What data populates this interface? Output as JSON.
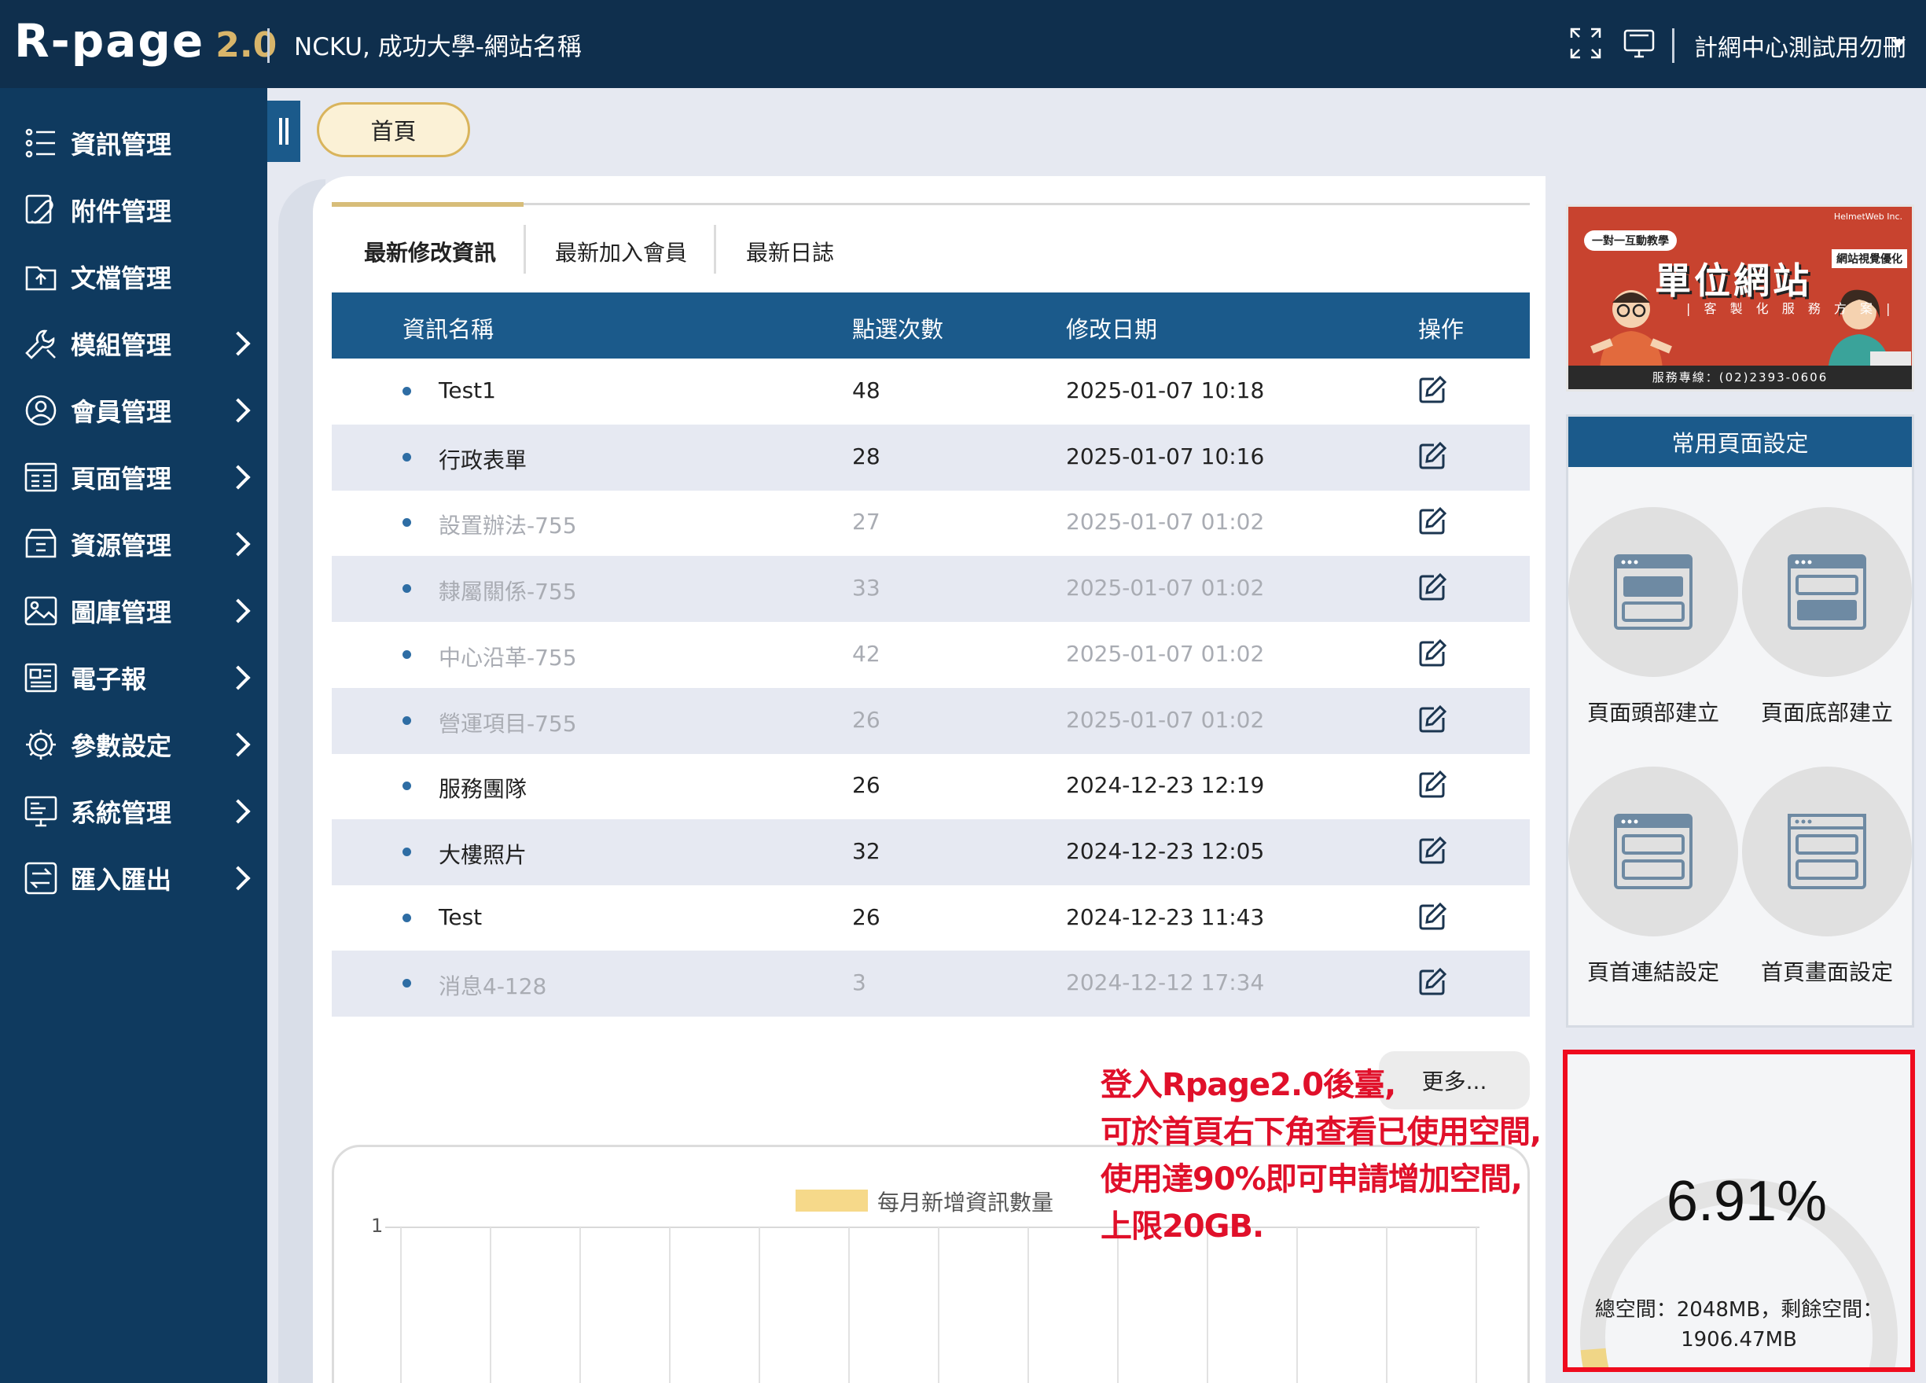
{
  "header": {
    "logo_main": "R-page",
    "logo_version": "2.0",
    "site_name": "NCKU, 成功大學-網站名稱",
    "user_name": "計網中心測試用勿刪",
    "icons": [
      "fullscreen-icon",
      "monitor-icon",
      "caret-down-icon"
    ]
  },
  "sidebar": {
    "items": [
      {
        "label": "資訊管理",
        "icon": "list-icon",
        "expandable": false
      },
      {
        "label": "附件管理",
        "icon": "attachment-icon",
        "expandable": false
      },
      {
        "label": "文檔管理",
        "icon": "document-upload-icon",
        "expandable": false
      },
      {
        "label": "模組管理",
        "icon": "wrench-icon",
        "expandable": true
      },
      {
        "label": "會員管理",
        "icon": "user-circle-icon",
        "expandable": true
      },
      {
        "label": "頁面管理",
        "icon": "page-layout-icon",
        "expandable": true
      },
      {
        "label": "資源管理",
        "icon": "archive-box-icon",
        "expandable": true
      },
      {
        "label": "圖庫管理",
        "icon": "image-icon",
        "expandable": true
      },
      {
        "label": "電子報",
        "icon": "newsletter-icon",
        "expandable": true
      },
      {
        "label": "參數設定",
        "icon": "gear-icon",
        "expandable": true
      },
      {
        "label": "系統管理",
        "icon": "monitor-icon",
        "expandable": true
      },
      {
        "label": "匯入匯出",
        "icon": "import-export-icon",
        "expandable": true
      }
    ]
  },
  "breadcrumb": {
    "home": "首頁"
  },
  "tabs": [
    {
      "label": "最新修改資訊",
      "active": true
    },
    {
      "label": "最新加入會員",
      "active": false
    },
    {
      "label": "最新日誌",
      "active": false
    }
  ],
  "table": {
    "columns": [
      "資訊名稱",
      "點選次數",
      "修改日期",
      "操作"
    ],
    "rows": [
      {
        "name": "Test1",
        "clicks": "48",
        "date": "2025-01-07 10:18",
        "muted": false
      },
      {
        "name": "行政表單",
        "clicks": "28",
        "date": "2025-01-07 10:16",
        "muted": false
      },
      {
        "name": "設置辦法-755",
        "clicks": "27",
        "date": "2025-01-07 01:02",
        "muted": true
      },
      {
        "name": "隸屬關係-755",
        "clicks": "33",
        "date": "2025-01-07 01:02",
        "muted": true
      },
      {
        "name": "中心沿革-755",
        "clicks": "42",
        "date": "2025-01-07 01:02",
        "muted": true
      },
      {
        "name": "營運項目-755",
        "clicks": "26",
        "date": "2025-01-07 01:02",
        "muted": true
      },
      {
        "name": "服務團隊",
        "clicks": "26",
        "date": "2024-12-23 12:19",
        "muted": false
      },
      {
        "name": "大樓照片",
        "clicks": "32",
        "date": "2024-12-23 12:05",
        "muted": false
      },
      {
        "name": "Test",
        "clicks": "26",
        "date": "2024-12-23 11:43",
        "muted": false
      },
      {
        "name": "消息4-128",
        "clicks": "3",
        "date": "2024-12-12 17:34",
        "muted": true
      }
    ],
    "more_label": "更多..."
  },
  "chart": {
    "legend": "每月新增資訊數量",
    "y_tick": "1",
    "legend_color": "#f6d98a"
  },
  "annotation": {
    "lines": [
      "登入Rpage2.0後臺,",
      "可於首頁右下角查看已使用空間,",
      "使用達90%即可申請增加空間,",
      "上限20GB."
    ],
    "color": "#e0102a"
  },
  "banner": {
    "badge": "一對一互動教學",
    "brand": "HelmetWeb Inc.",
    "title": "單位網站",
    "tag": "網站視覺優化",
    "subtitle": "| 客 製 化 服 務 方 案 |",
    "footer": "服務專線：(02)2393-0606"
  },
  "common_settings": {
    "title": "常用頁面設定",
    "items": [
      {
        "label": "頁面頭部建立",
        "icon": "page-header-icon"
      },
      {
        "label": "頁面底部建立",
        "icon": "page-footer-icon"
      },
      {
        "label": "頁首連結設定",
        "icon": "header-link-icon"
      },
      {
        "label": "首頁畫面設定",
        "icon": "homepage-layout-icon"
      }
    ]
  },
  "usage": {
    "percent_label": "6.91%",
    "percent": 6.91,
    "total_line": "總空間：2048MB，剩餘空間：",
    "remaining": "1906.47MB",
    "gauge_color": "#f0d687",
    "track_color": "#e3e3e3"
  }
}
